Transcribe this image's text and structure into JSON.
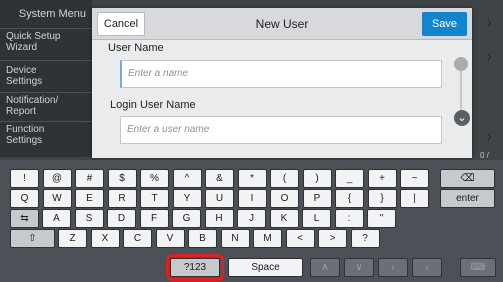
{
  "sidebar": {
    "title": "System Menu",
    "items": [
      {
        "label": "Quick Setup\nWizard"
      },
      {
        "label": "Device\nSettings"
      },
      {
        "label": "Notification/\nReport"
      },
      {
        "label": "Function\nSettings"
      }
    ]
  },
  "dialog": {
    "cancel_label": "Cancel",
    "title": "New User",
    "save_label": "Save",
    "user_name_label": "User Name",
    "user_name_placeholder": "Enter a name",
    "login_user_name_label": "Login User Name",
    "login_user_name_placeholder": "Enter a user name"
  },
  "pager": "0 /",
  "keyboard": {
    "row1": [
      "!",
      "@",
      "#",
      "$",
      "%",
      "^",
      "&",
      "*",
      "(",
      ")",
      "_",
      "+",
      "~"
    ],
    "row2": [
      "Q",
      "W",
      "E",
      "R",
      "T",
      "Y",
      "U",
      "I",
      "O",
      "P",
      "{",
      "}",
      "|"
    ],
    "row3": [
      "A",
      "S",
      "D",
      "F",
      "G",
      "H",
      "J",
      "K",
      "L",
      ":",
      "\""
    ],
    "row4": [
      "Z",
      "X",
      "C",
      "V",
      "B",
      "N",
      "M",
      "<",
      ">",
      "?"
    ],
    "backspace_label": "⌫",
    "enter_label": "enter",
    "tab_label": "⇆",
    "shift_label": "⇧",
    "symbol_toggle_label": "?123",
    "space_label": "Space",
    "keyboard_hide_label": "⌨"
  },
  "colors": {
    "save_button": "#1584cf",
    "highlight": "#e02020"
  }
}
